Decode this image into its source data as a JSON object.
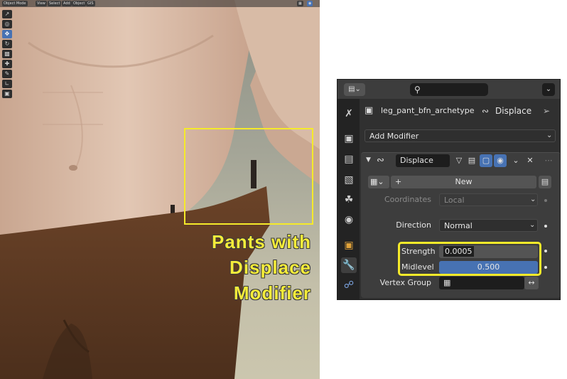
{
  "viewport": {
    "header_items": [
      "Object Mode",
      "View",
      "Select",
      "Add",
      "Object",
      "GIS"
    ],
    "tools": [
      "select-tool",
      "cursor-tool",
      "move-tool",
      "rotate-tool",
      "scale-tool",
      "transform-tool",
      "annotate-tool",
      "measure-tool",
      "add-cube-tool"
    ],
    "callout_text": "Pants with\nDisplace\nModifier",
    "callout_color": "#f5ea2a"
  },
  "panel": {
    "object_name": "leg_pant_bfn_archetype",
    "modifier_crumb": "Displace",
    "add_modifier_label": "Add Modifier",
    "modifier_name": "Displace",
    "texture_new_label": "New",
    "coordinates_label": "Coordinates",
    "coordinates_value": "Local",
    "direction_label": "Direction",
    "direction_value": "Normal",
    "strength_label": "Strength",
    "strength_value": "0.0005",
    "midlevel_label": "Midlevel",
    "midlevel_value": "0.500",
    "vertex_group_label": "Vertex Group",
    "accent_color": "#4772b3",
    "highlight_color": "#f5ea2a"
  }
}
